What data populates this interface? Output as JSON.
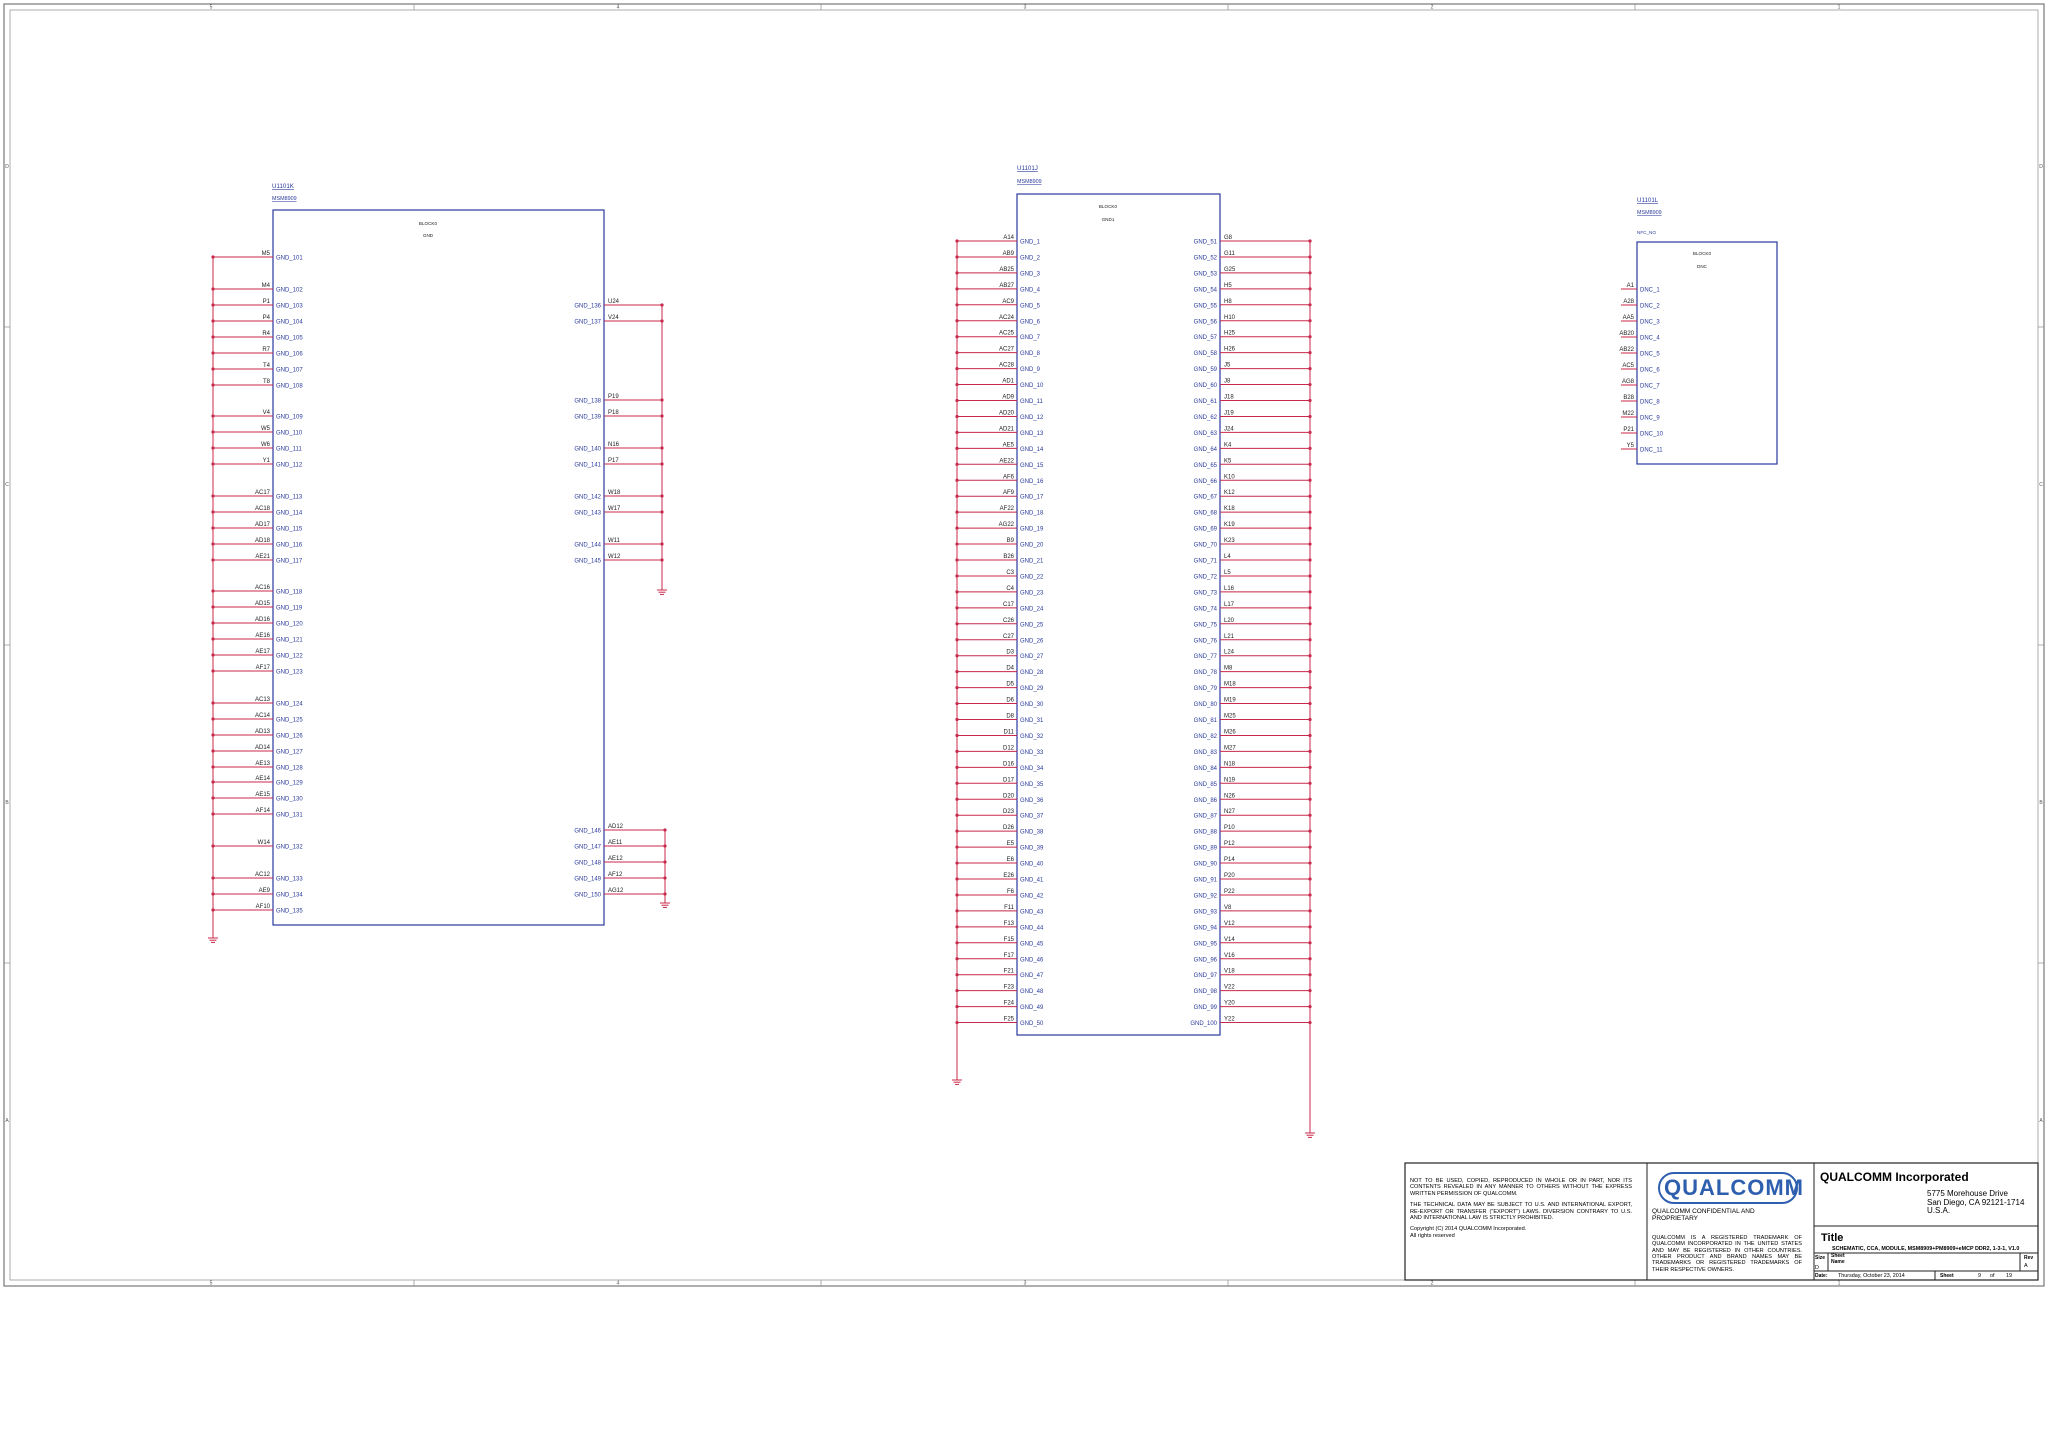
{
  "border": {
    "col_markers": [
      "8",
      "7",
      "6",
      "5",
      "4",
      "3",
      "2",
      "1"
    ],
    "row_markers": [
      "D",
      "C",
      "B",
      "A"
    ]
  },
  "parts": [
    {
      "ref": "U1101K",
      "part": "MSM8909",
      "block_label": "BLOCK0",
      "block_name": "GND",
      "left_pins": [
        {
          "pin": "M5",
          "net": "GND_101"
        },
        {
          "pin": "M4",
          "net": "GND_102"
        },
        {
          "pin": "P1",
          "net": "GND_103"
        },
        {
          "pin": "P4",
          "net": "GND_104"
        },
        {
          "pin": "R4",
          "net": "GND_105"
        },
        {
          "pin": "R7",
          "net": "GND_106"
        },
        {
          "pin": "T4",
          "net": "GND_107"
        },
        {
          "pin": "T8",
          "net": "GND_108"
        },
        {
          "pin": "V4",
          "net": "GND_109"
        },
        {
          "pin": "W5",
          "net": "GND_110"
        },
        {
          "pin": "W6",
          "net": "GND_111"
        },
        {
          "pin": "Y1",
          "net": "GND_112"
        },
        {
          "pin": "AC17",
          "net": "GND_113"
        },
        {
          "pin": "AC18",
          "net": "GND_114"
        },
        {
          "pin": "AD17",
          "net": "GND_115"
        },
        {
          "pin": "AD18",
          "net": "GND_116"
        },
        {
          "pin": "AE21",
          "net": "GND_117"
        },
        {
          "pin": "AC16",
          "net": "GND_118"
        },
        {
          "pin": "AD15",
          "net": "GND_119"
        },
        {
          "pin": "AD16",
          "net": "GND_120"
        },
        {
          "pin": "AE16",
          "net": "GND_121"
        },
        {
          "pin": "AE17",
          "net": "GND_122"
        },
        {
          "pin": "AF17",
          "net": "GND_123"
        },
        {
          "pin": "AC13",
          "net": "GND_124"
        },
        {
          "pin": "AC14",
          "net": "GND_125"
        },
        {
          "pin": "AD13",
          "net": "GND_126"
        },
        {
          "pin": "AD14",
          "net": "GND_127"
        },
        {
          "pin": "AE13",
          "net": "GND_128"
        },
        {
          "pin": "AE14",
          "net": "GND_129"
        },
        {
          "pin": "AE15",
          "net": "GND_130"
        },
        {
          "pin": "AF14",
          "net": "GND_131"
        },
        {
          "pin": "W14",
          "net": "GND_132"
        },
        {
          "pin": "AC12",
          "net": "GND_133"
        },
        {
          "pin": "AE9",
          "net": "GND_134"
        },
        {
          "pin": "AF10",
          "net": "GND_135"
        }
      ],
      "right_pins": [
        {
          "pin": "U24",
          "net": "GND_136"
        },
        {
          "pin": "V24",
          "net": "GND_137"
        },
        {
          "pin": "P19",
          "net": "GND_138"
        },
        {
          "pin": "P18",
          "net": "GND_139"
        },
        {
          "pin": "N16",
          "net": "GND_140"
        },
        {
          "pin": "P17",
          "net": "GND_141"
        },
        {
          "pin": "W18",
          "net": "GND_142"
        },
        {
          "pin": "W17",
          "net": "GND_143"
        },
        {
          "pin": "W11",
          "net": "GND_144"
        },
        {
          "pin": "W12",
          "net": "GND_145"
        },
        {
          "pin": "AD12",
          "net": "GND_146"
        },
        {
          "pin": "AE11",
          "net": "GND_147"
        },
        {
          "pin": "AE12",
          "net": "GND_148"
        },
        {
          "pin": "AF12",
          "net": "GND_149"
        },
        {
          "pin": "AG12",
          "net": "GND_150"
        }
      ]
    },
    {
      "ref": "U1101J",
      "part": "MSM8909",
      "block_label": "BLOCK0",
      "block_name": "GND1",
      "left_pins": [
        {
          "pin": "A14",
          "net": "GND_1"
        },
        {
          "pin": "AB9",
          "net": "GND_2"
        },
        {
          "pin": "AB25",
          "net": "GND_3"
        },
        {
          "pin": "AB27",
          "net": "GND_4"
        },
        {
          "pin": "AC9",
          "net": "GND_5"
        },
        {
          "pin": "AC24",
          "net": "GND_6"
        },
        {
          "pin": "AC25",
          "net": "GND_7"
        },
        {
          "pin": "AC27",
          "net": "GND_8"
        },
        {
          "pin": "AC28",
          "net": "GND_9"
        },
        {
          "pin": "AD1",
          "net": "GND_10"
        },
        {
          "pin": "AD9",
          "net": "GND_11"
        },
        {
          "pin": "AD20",
          "net": "GND_12"
        },
        {
          "pin": "AD21",
          "net": "GND_13"
        },
        {
          "pin": "AE5",
          "net": "GND_14"
        },
        {
          "pin": "AE22",
          "net": "GND_15"
        },
        {
          "pin": "AF6",
          "net": "GND_16"
        },
        {
          "pin": "AF9",
          "net": "GND_17"
        },
        {
          "pin": "AF22",
          "net": "GND_18"
        },
        {
          "pin": "AG22",
          "net": "GND_19"
        },
        {
          "pin": "B9",
          "net": "GND_20"
        },
        {
          "pin": "B26",
          "net": "GND_21"
        },
        {
          "pin": "C3",
          "net": "GND_22"
        },
        {
          "pin": "C4",
          "net": "GND_23"
        },
        {
          "pin": "C17",
          "net": "GND_24"
        },
        {
          "pin": "C26",
          "net": "GND_25"
        },
        {
          "pin": "C27",
          "net": "GND_26"
        },
        {
          "pin": "D3",
          "net": "GND_27"
        },
        {
          "pin": "D4",
          "net": "GND_28"
        },
        {
          "pin": "D5",
          "net": "GND_29"
        },
        {
          "pin": "D6",
          "net": "GND_30"
        },
        {
          "pin": "D8",
          "net": "GND_31"
        },
        {
          "pin": "D11",
          "net": "GND_32"
        },
        {
          "pin": "D12",
          "net": "GND_33"
        },
        {
          "pin": "D16",
          "net": "GND_34"
        },
        {
          "pin": "D17",
          "net": "GND_35"
        },
        {
          "pin": "D20",
          "net": "GND_36"
        },
        {
          "pin": "D23",
          "net": "GND_37"
        },
        {
          "pin": "D26",
          "net": "GND_38"
        },
        {
          "pin": "E5",
          "net": "GND_39"
        },
        {
          "pin": "E6",
          "net": "GND_40"
        },
        {
          "pin": "E26",
          "net": "GND_41"
        },
        {
          "pin": "F6",
          "net": "GND_42"
        },
        {
          "pin": "F11",
          "net": "GND_43"
        },
        {
          "pin": "F13",
          "net": "GND_44"
        },
        {
          "pin": "F15",
          "net": "GND_45"
        },
        {
          "pin": "F17",
          "net": "GND_46"
        },
        {
          "pin": "F21",
          "net": "GND_47"
        },
        {
          "pin": "F23",
          "net": "GND_48"
        },
        {
          "pin": "F24",
          "net": "GND_49"
        },
        {
          "pin": "F25",
          "net": "GND_50"
        }
      ],
      "right_pins": [
        {
          "pin": "G8",
          "net": "GND_51"
        },
        {
          "pin": "G11",
          "net": "GND_52"
        },
        {
          "pin": "G25",
          "net": "GND_53"
        },
        {
          "pin": "H5",
          "net": "GND_54"
        },
        {
          "pin": "H8",
          "net": "GND_55"
        },
        {
          "pin": "H10",
          "net": "GND_56"
        },
        {
          "pin": "H25",
          "net": "GND_57"
        },
        {
          "pin": "H26",
          "net": "GND_58"
        },
        {
          "pin": "J5",
          "net": "GND_59"
        },
        {
          "pin": "J8",
          "net": "GND_60"
        },
        {
          "pin": "J18",
          "net": "GND_61"
        },
        {
          "pin": "J19",
          "net": "GND_62"
        },
        {
          "pin": "J24",
          "net": "GND_63"
        },
        {
          "pin": "K4",
          "net": "GND_64"
        },
        {
          "pin": "K5",
          "net": "GND_65"
        },
        {
          "pin": "K10",
          "net": "GND_66"
        },
        {
          "pin": "K12",
          "net": "GND_67"
        },
        {
          "pin": "K18",
          "net": "GND_68"
        },
        {
          "pin": "K19",
          "net": "GND_69"
        },
        {
          "pin": "K23",
          "net": "GND_70"
        },
        {
          "pin": "L4",
          "net": "GND_71"
        },
        {
          "pin": "L5",
          "net": "GND_72"
        },
        {
          "pin": "L16",
          "net": "GND_73"
        },
        {
          "pin": "L17",
          "net": "GND_74"
        },
        {
          "pin": "L20",
          "net": "GND_75"
        },
        {
          "pin": "L21",
          "net": "GND_76"
        },
        {
          "pin": "L24",
          "net": "GND_77"
        },
        {
          "pin": "M8",
          "net": "GND_78"
        },
        {
          "pin": "M18",
          "net": "GND_79"
        },
        {
          "pin": "M19",
          "net": "GND_80"
        },
        {
          "pin": "M25",
          "net": "GND_81"
        },
        {
          "pin": "M26",
          "net": "GND_82"
        },
        {
          "pin": "M27",
          "net": "GND_83"
        },
        {
          "pin": "N18",
          "net": "GND_84"
        },
        {
          "pin": "N19",
          "net": "GND_85"
        },
        {
          "pin": "N26",
          "net": "GND_86"
        },
        {
          "pin": "N27",
          "net": "GND_87"
        },
        {
          "pin": "P10",
          "net": "GND_88"
        },
        {
          "pin": "P12",
          "net": "GND_89"
        },
        {
          "pin": "P14",
          "net": "GND_90"
        },
        {
          "pin": "P20",
          "net": "GND_91"
        },
        {
          "pin": "P22",
          "net": "GND_92"
        },
        {
          "pin": "V8",
          "net": "GND_93"
        },
        {
          "pin": "V12",
          "net": "GND_94"
        },
        {
          "pin": "V14",
          "net": "GND_95"
        },
        {
          "pin": "V16",
          "net": "GND_96"
        },
        {
          "pin": "V18",
          "net": "GND_97"
        },
        {
          "pin": "V22",
          "net": "GND_98"
        },
        {
          "pin": "Y20",
          "net": "GND_99"
        },
        {
          "pin": "Y22",
          "net": "GND_100"
        }
      ]
    },
    {
      "ref": "U1101L",
      "part": "MSM8909",
      "header": "NFC_NO",
      "block_label": "BLOCK0",
      "block_name": "DNC",
      "left_pins": [
        {
          "pin": "A1",
          "net": "DNC_1"
        },
        {
          "pin": "A28",
          "net": "DNC_2"
        },
        {
          "pin": "AA5",
          "net": "DNC_3"
        },
        {
          "pin": "AB20",
          "net": "DNC_4"
        },
        {
          "pin": "AB22",
          "net": "DNC_5"
        },
        {
          "pin": "AC5",
          "net": "DNC_6"
        },
        {
          "pin": "AG8",
          "net": "DNC_7"
        },
        {
          "pin": "B28",
          "net": "DNC_8"
        },
        {
          "pin": "M22",
          "net": "DNC_9"
        },
        {
          "pin": "P21",
          "net": "DNC_10"
        },
        {
          "pin": "Y5",
          "net": "DNC_11"
        }
      ],
      "right_pins": []
    }
  ],
  "title_block": {
    "legal_1": "NOT TO BE USED, COPIED, REPRODUCED IN WHOLE OR IN PART, NOR ITS CONTENTS REVEALED IN ANY MANNER TO OTHERS WITHOUT THE EXPRESS WRITTEN PERMISSION OF QUALCOMM.",
    "legal_2": "THE TECHNICAL DATA MAY BE SUBJECT TO U.S. AND INTERNATIONAL EXPORT, RE-EXPORT OR TRANSFER (\"EXPORT\") LAWS. DIVERSION CONTRARY TO U.S. AND INTERNATIONAL LAW IS STRICTLY PROHIBITED.",
    "copyright": "Copyright (C) 2014 QUALCOMM Incorporated.",
    "rights": "All rights reserved",
    "logo": "QUALCOMM",
    "confidential": "QUALCOMM CONFIDENTIAL AND PROPRIETARY",
    "trademark": "QUALCOMM IS A REGISTERED TRADEMARK OF QUALCOMM INCORPORATED IN THE UNITED STATES AND MAY BE REGISTERED IN OTHER COUNTRIES. OTHER PRODUCT AND BRAND NAMES MAY BE TRADEMARKS OR REGISTERED TRADEMARKS OF THEIR RESPECTIVE OWNERS.",
    "company": "QUALCOMM Incorporated",
    "address_1": "5775 Morehouse Drive",
    "address_2": "San Diego, CA 92121-1714",
    "address_3": "U.S.A.",
    "title_label": "Title",
    "doc_name": "SCHEMATIC, CCA, MODULE, MSM8909+PM8909+eMCP DDR2, 1-3-1, V1.0",
    "size_label": "Size",
    "size_value": "D",
    "sheet_name_label": "Sheet Name",
    "rev_label": "Rev",
    "rev_value": "A",
    "date_label": "Date:",
    "date_value": "Thursday, October 23, 2014",
    "sheet_label": "Sheet",
    "sheet_num": "9",
    "of_label": "of",
    "sheet_total": "19"
  }
}
